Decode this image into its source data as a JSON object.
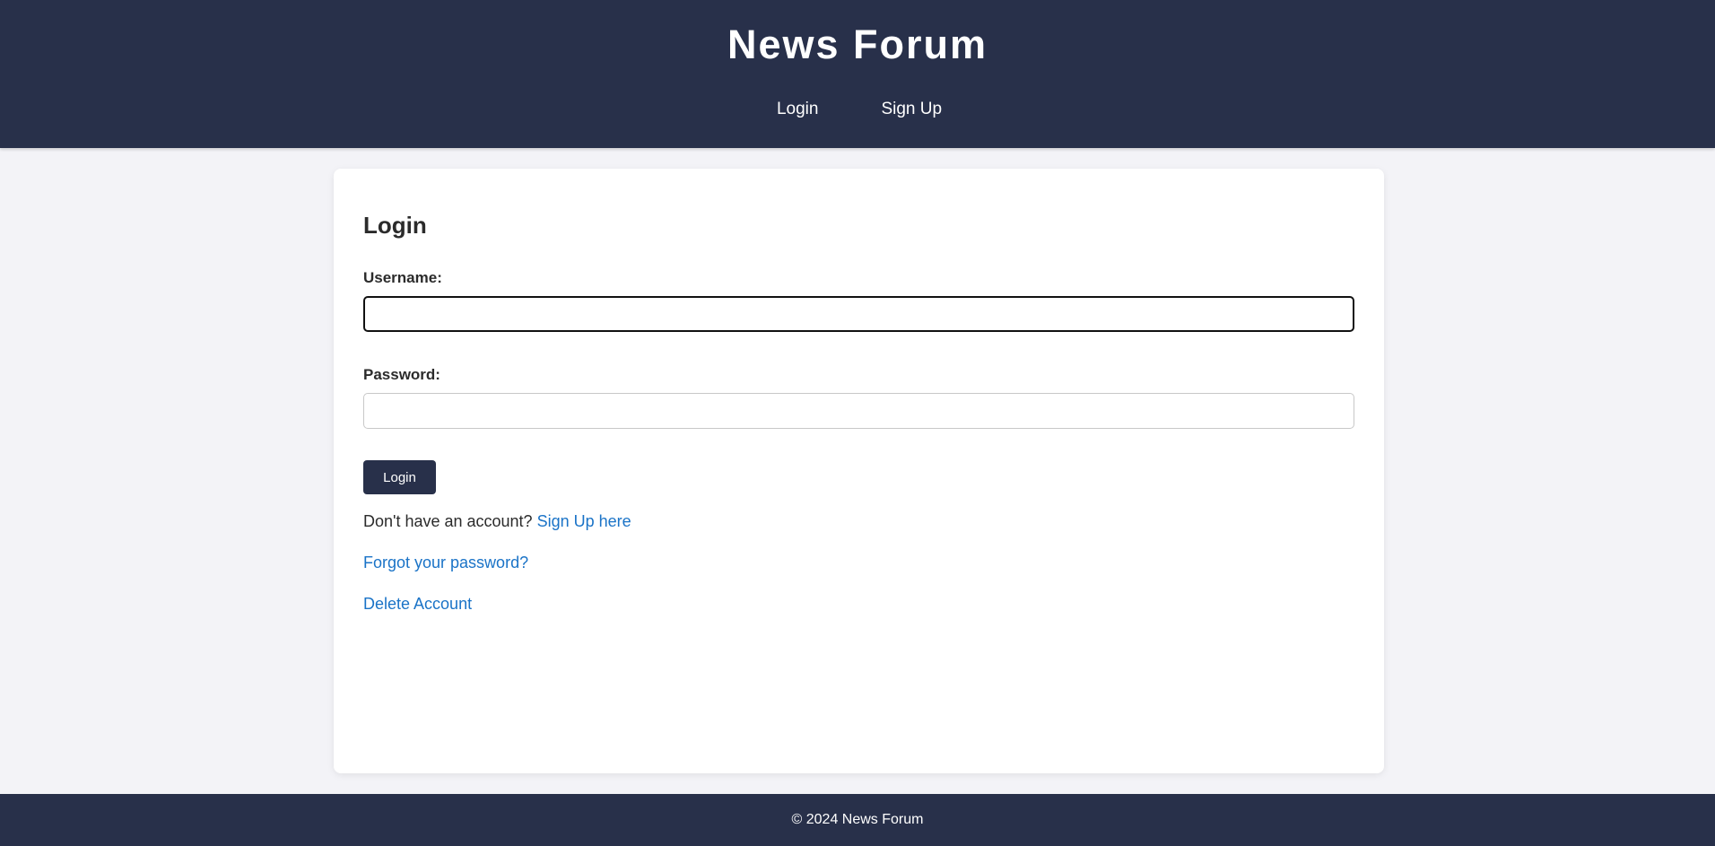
{
  "header": {
    "title": "News Forum",
    "nav": {
      "login": "Login",
      "signup": "Sign Up"
    }
  },
  "login_form": {
    "heading": "Login",
    "username_label": "Username:",
    "username_value": "",
    "password_label": "Password:",
    "password_value": "",
    "submit_label": "Login",
    "no_account_text": "Don't have an account?",
    "signup_link": "Sign Up here",
    "forgot_link": "Forgot your password?",
    "delete_link": "Delete Account"
  },
  "footer": {
    "text": "© 2024 News Forum"
  },
  "colors": {
    "header_bg": "#28304a",
    "page_bg": "#f3f3f7",
    "link": "#1a73c7",
    "button_bg": "#28304a"
  }
}
